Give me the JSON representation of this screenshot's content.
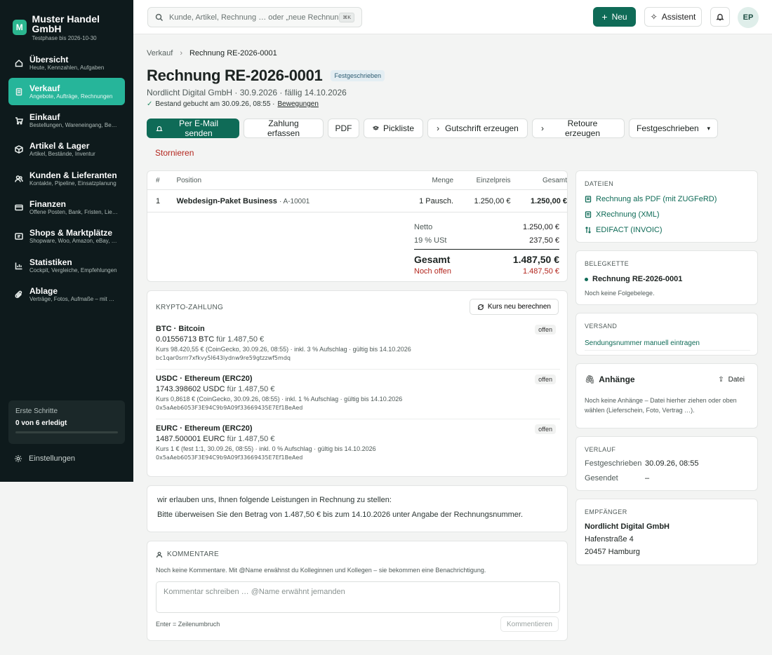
{
  "brand": {
    "logo": "M",
    "name": "Muster Handel GmbH",
    "sub": "Testphase bis 2026-10-30"
  },
  "nav": [
    {
      "label": "Übersicht",
      "sub": "Heute, Kennzahlen, Aufgaben"
    },
    {
      "label": "Verkauf",
      "sub": "Angebote, Aufträge, Rechnungen"
    },
    {
      "label": "Einkauf",
      "sub": "Bestellungen, Wareneingang, Bestellvorschläge"
    },
    {
      "label": "Artikel & Lager",
      "sub": "Artikel, Bestände, Inventur"
    },
    {
      "label": "Kunden & Lieferanten",
      "sub": "Kontakte, Pipeline, Einsatzplanung"
    },
    {
      "label": "Finanzen",
      "sub": "Offene Posten, Bank, Fristen, Lieferanten"
    },
    {
      "label": "Shops & Marktplätze",
      "sub": "Shopware, Woo, Amazon, eBay, Kaufland"
    },
    {
      "label": "Statistiken",
      "sub": "Cockpit, Vergleiche, Empfehlungen"
    },
    {
      "label": "Ablage",
      "sub": "Verträge, Fotos, Aufmaße – mit Suche"
    }
  ],
  "onboarding": {
    "title": "Erste Schritte",
    "value": "0 von 6 erledigt",
    "progress": 0
  },
  "settings_label": "Einstellungen",
  "topbar": {
    "search_placeholder": "Kunde, Artikel, Rechnung … oder „neue Rechnung“",
    "kbd": "⌘K",
    "new_label": "Neu",
    "assistant_label": "Assistent",
    "avatar": "EP"
  },
  "breadcrumb": {
    "parent": "Verkauf",
    "current": "Rechnung RE-2026-0001"
  },
  "invoice": {
    "title": "Rechnung RE-2026-0001",
    "status": "Festgeschrieben",
    "subtitle": "Nordlicht Digital GmbH · 30.9.2026 · fällig 14.10.2026",
    "stock_note": "Bestand gebucht am 30.09.26, 08:55 ·",
    "stock_link": "Bewegungen"
  },
  "actions": {
    "email": "Per E-Mail senden",
    "payment": "Zahlung erfassen",
    "pdf": "PDF",
    "picklist": "Pickliste",
    "credit": "Gutschrift erzeugen",
    "return": "Retoure erzeugen",
    "status_select": "Festgeschrieben",
    "cancel": "Stornieren"
  },
  "table": {
    "headers": {
      "num": "#",
      "pos": "Position",
      "qty": "Menge",
      "unit": "Einzelpreis",
      "total": "Gesamt"
    },
    "rows": [
      {
        "num": "1",
        "name": "Webdesign-Paket Business",
        "sku": "· A-10001",
        "qty": "1 Pausch.",
        "unit": "1.250,00 €",
        "total": "1.250,00 €"
      }
    ]
  },
  "totals": {
    "net_label": "Netto",
    "net": "1.250,00 €",
    "vat_label": "19 % USt",
    "vat": "237,50 €",
    "gross_label": "Gesamt",
    "gross": "1.487,50 €",
    "open_label": "Noch offen",
    "open": "1.487,50 €"
  },
  "crypto": {
    "title": "KRYPTO-ZAHLUNG",
    "recalc": "Kurs neu berechnen",
    "coins": [
      {
        "name": "BTC · Bitcoin",
        "amount": "0.01556713 BTC",
        "for": "für 1.487,50 €",
        "meta": "Kurs 98.420,55 € (CoinGecko, 30.09.26, 08:55) · inkl. 3 % Aufschlag · gültig bis 14.10.2026",
        "addr": "bc1qar0srrr7xfkvy5l643lydnw9re59gtzzwf5mdq",
        "status": "offen"
      },
      {
        "name": "USDC · Ethereum (ERC20)",
        "amount": "1743.398602 USDC",
        "for": "für 1.487,50 €",
        "meta": "Kurs 0,8618 € (CoinGecko, 30.09.26, 08:55) · inkl. 1 % Aufschlag · gültig bis 14.10.2026",
        "addr": "0x5aAeb6053F3E94C9b9A09f33669435E7Ef1BeAed",
        "status": "offen"
      },
      {
        "name": "EURC · Ethereum (ERC20)",
        "amount": "1487.500001 EURC",
        "for": "für 1.487,50 €",
        "meta": "Kurs 1 € (fest 1:1, 30.09.26, 08:55) · inkl. 0 % Aufschlag · gültig bis 14.10.2026",
        "addr": "0x5aAeb6053F3E94C9b9A09f33669435E7Ef1BeAed",
        "status": "offen"
      }
    ]
  },
  "notes": {
    "line1": "wir erlauben uns, Ihnen folgende Leistungen in Rechnung zu stellen:",
    "line2": "Bitte überweisen Sie den Betrag von 1.487,50 € bis zum 14.10.2026 unter Angabe der Rechnungsnummer."
  },
  "comments": {
    "title": "KOMMENTARE",
    "hint": "Noch keine Kommentare. Mit @Name erwähnst du Kolleginnen und Kollegen – sie bekommen eine Benachrichtigung.",
    "placeholder": "Kommentar schreiben … @Name erwähnt jemanden",
    "footer": "Enter = Zeilenumbruch",
    "submit": "Kommentieren"
  },
  "files": {
    "title": "DATEIEN",
    "items": [
      "Rechnung als PDF (mit ZUGFeRD)",
      "XRechnung (XML)",
      "EDIFACT (INVOIC)"
    ]
  },
  "chain": {
    "title": "BELEGKETTE",
    "current": "Rechnung RE-2026-0001",
    "note": "Noch keine Folgebelege."
  },
  "shipping": {
    "title": "VERSAND",
    "link": "Sendungsnummer manuell eintragen"
  },
  "attachments": {
    "title": "Anhänge",
    "button": "Datei",
    "hint": "Noch keine Anhänge – Datei hierher ziehen oder oben wählen (Lieferschein, Foto, Vertrag …)."
  },
  "history": {
    "title": "VERLAUF",
    "rows": [
      {
        "label": "Festgeschrieben",
        "value": "30.09.26, 08:55"
      },
      {
        "label": "Gesendet",
        "value": "–"
      }
    ]
  },
  "recipient": {
    "title": "EMPFÄNGER",
    "name": "Nordlicht Digital GmbH",
    "street": "Hafenstraße 4",
    "city": "20457 Hamburg"
  }
}
